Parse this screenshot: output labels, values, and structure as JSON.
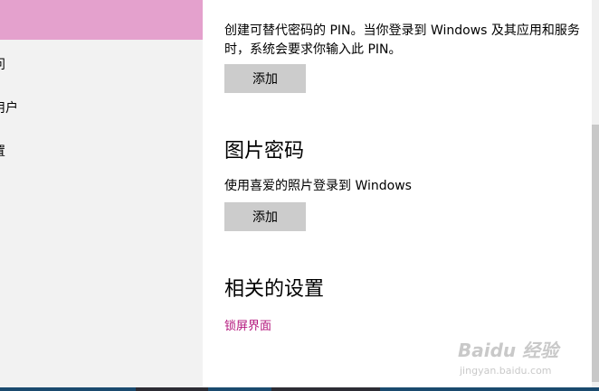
{
  "sidebar": {
    "items": [
      {
        "label": "问"
      },
      {
        "label": "用户"
      },
      {
        "label": "置"
      }
    ]
  },
  "pin": {
    "description": "创建可替代密码的 PIN。当你登录到 Windows 及其应用和服务时，系统会要求你输入此 PIN。",
    "add_label": "添加"
  },
  "picture_password": {
    "heading": "图片密码",
    "description": "使用喜爱的照片登录到 Windows",
    "add_label": "添加"
  },
  "related": {
    "heading": "相关的设置",
    "link": "锁屏界面"
  },
  "watermark": {
    "logo": "Baidu 经验",
    "url": "jingyan.baidu.com"
  },
  "colors": {
    "accent": "#b4187e",
    "selected_nav": "#e4a1cd",
    "button_bg": "#cccccc"
  }
}
